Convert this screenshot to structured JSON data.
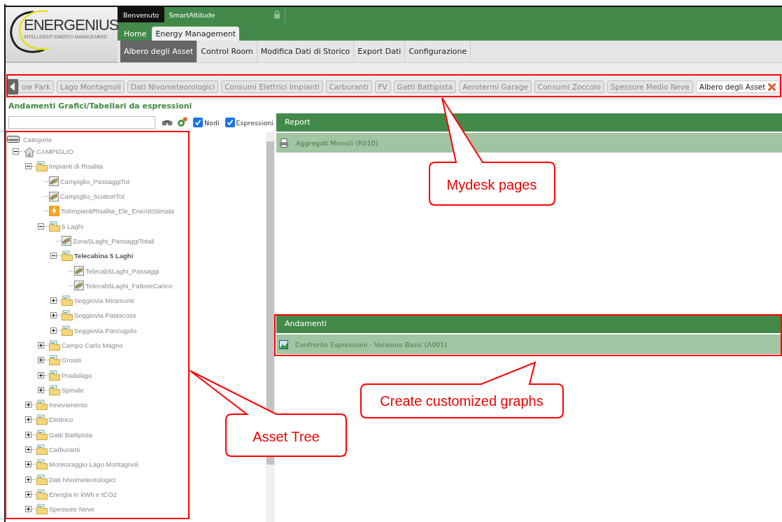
{
  "header": {
    "logo": {
      "name": "ENERGENIUS",
      "tagline": "INTELLIGENT ENERGY MANAGEMENT"
    },
    "welcome": "Benvenuto",
    "user": "SmartAltitude",
    "main_tabs": [
      {
        "label": "Home",
        "selected": false
      },
      {
        "label": "Energy Management",
        "selected": true
      }
    ],
    "submenu": [
      {
        "label": "Albero degli Asset",
        "selected": true
      },
      {
        "label": "Control Room",
        "selected": false
      },
      {
        "label": "Modifica Dati di Storico",
        "selected": false
      },
      {
        "label": "Export Dati",
        "selected": false
      },
      {
        "label": "Configurazione",
        "selected": false
      }
    ]
  },
  "page_tabs": [
    {
      "label": "ow Park",
      "selected": false
    },
    {
      "label": "Lago Montagnoli",
      "selected": false
    },
    {
      "label": "Dati Nivometeorologici",
      "selected": false
    },
    {
      "label": "Consumi Elettrici Impianti",
      "selected": false
    },
    {
      "label": "Carburanti",
      "selected": false
    },
    {
      "label": "FV",
      "selected": false
    },
    {
      "label": "Gatti Battipista",
      "selected": false
    },
    {
      "label": "Aerotermi Garage",
      "selected": false
    },
    {
      "label": "Consumi Zoccolo",
      "selected": false
    },
    {
      "label": "Spessore Medio Neve",
      "selected": false
    },
    {
      "label": "Albero degli Asset",
      "selected": true
    }
  ],
  "page_title": "Andamenti Grafici/Tabellari da espressioni",
  "checkboxes": [
    {
      "label": "Nodi",
      "checked": true
    },
    {
      "label": "Espressioni",
      "checked": true
    }
  ],
  "tree": {
    "root": {
      "label": "Categorie"
    },
    "nodes": [
      {
        "label": "CAMPIGLIO",
        "kind": "home",
        "expanded": true,
        "selected": false,
        "children": [
          {
            "label": "Impianti di Risalita",
            "kind": "folder",
            "expanded": true,
            "selected": false,
            "children": [
              {
                "label": "Campiglio_PassaggiTot",
                "kind": "expression",
                "selected": false
              },
              {
                "label": "Campiglio_SciatoriTot",
                "kind": "expression",
                "selected": false
              },
              {
                "label": "TotImpiantiRisalita_Ele_EneAttStimata",
                "kind": "energy",
                "selected": false
              },
              {
                "label": "5 Laghi",
                "kind": "folder",
                "expanded": true,
                "selected": false,
                "children": [
                  {
                    "label": "Zona5Laghi_PassaggiTotali",
                    "kind": "expression",
                    "selected": false
                  },
                  {
                    "label": "Telecabina 5 Laghi",
                    "kind": "folder",
                    "expanded": true,
                    "selected": true,
                    "children": [
                      {
                        "label": "Telecab5Laghi_Passaggi",
                        "kind": "expression",
                        "selected": false
                      },
                      {
                        "label": "Telecab5Laghi_FattoreCarico",
                        "kind": "expression",
                        "selected": false
                      }
                    ]
                  },
                  {
                    "label": "Seggiovia Miramonti",
                    "kind": "folder",
                    "expanded": false,
                    "selected": false
                  },
                  {
                    "label": "Seggiovia Patascoss",
                    "kind": "folder",
                    "expanded": false,
                    "selected": false
                  },
                  {
                    "label": "Seggiovia Pancugolo",
                    "kind": "folder",
                    "expanded": false,
                    "selected": false
                  }
                ]
              },
              {
                "label": "Campo Carlo Magno",
                "kind": "folder",
                "expanded": false,
                "selected": false
              },
              {
                "label": "Grostè",
                "kind": "folder",
                "expanded": false,
                "selected": false
              },
              {
                "label": "Pradalago",
                "kind": "folder",
                "expanded": false,
                "selected": false
              },
              {
                "label": "Spinale",
                "kind": "folder",
                "expanded": false,
                "selected": false
              }
            ]
          },
          {
            "label": "Innevamento",
            "kind": "folder",
            "expanded": false,
            "selected": false
          },
          {
            "label": "Elettrico",
            "kind": "folder",
            "expanded": false,
            "selected": false
          },
          {
            "label": "Gatti Battipista",
            "kind": "folder",
            "expanded": false,
            "selected": false
          },
          {
            "label": "Carburanti",
            "kind": "folder",
            "expanded": false,
            "selected": false
          },
          {
            "label": "Monitoraggio Lago Montagnoli",
            "kind": "folder",
            "expanded": false,
            "selected": false
          },
          {
            "label": "Dati Nivometeorologici",
            "kind": "folder",
            "expanded": false,
            "selected": false
          },
          {
            "label": "Energia in kWh e tCO2",
            "kind": "folder",
            "expanded": false,
            "selected": false
          },
          {
            "label": "Spessore Neve",
            "kind": "folder",
            "expanded": false,
            "selected": false
          }
        ]
      }
    ]
  },
  "sections": [
    {
      "title": "Report",
      "items": [
        {
          "kind": "printer",
          "label": "Aggregati Mensili (R010)"
        }
      ]
    },
    {
      "title": "Andamenti",
      "items": [
        {
          "kind": "chart",
          "label": "Confronto Espressioni - Versione Basic (A001)"
        }
      ]
    }
  ],
  "annotations": [
    {
      "text": "Mydesk pages"
    },
    {
      "text": "Create customized graphs"
    },
    {
      "text": "Asset Tree"
    }
  ]
}
